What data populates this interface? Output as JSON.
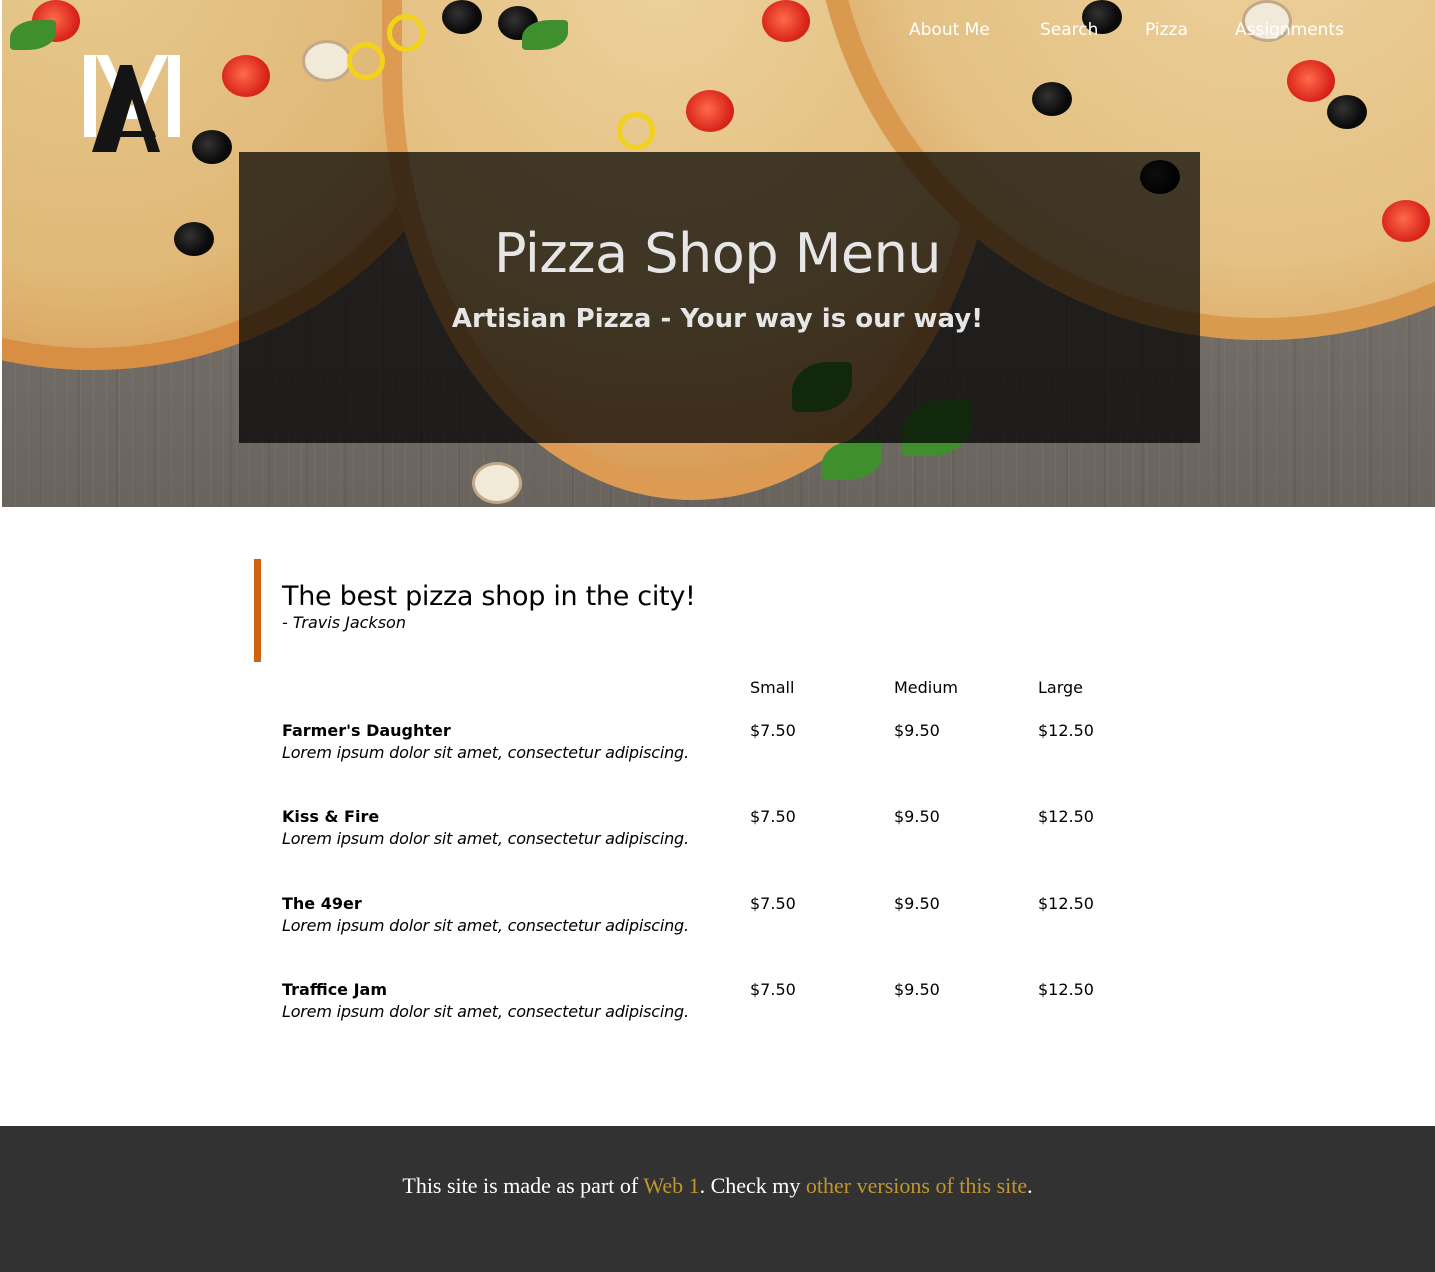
{
  "nav": {
    "items": [
      {
        "label": "About Me"
      },
      {
        "label": "Search"
      },
      {
        "label": "Pizza"
      },
      {
        "label": "Assignments"
      }
    ]
  },
  "logo": {
    "icon": "ma-monogram-logo-icon"
  },
  "hero": {
    "title": "Pizza Shop Menu",
    "subtitle": "Artisian Pizza - Your way is our way!"
  },
  "quote": {
    "text": "The best pizza shop in the city!",
    "author": "- Travis Jackson",
    "accent_color": "#d0630f"
  },
  "menu": {
    "columns": [
      "Small",
      "Medium",
      "Large"
    ],
    "items": [
      {
        "name": "Farmer's Daughter",
        "description": "Lorem ipsum dolor sit amet, consectetur adipiscing.",
        "prices": [
          "$7.50",
          "$9.50",
          "$12.50"
        ]
      },
      {
        "name": "Kiss & Fire",
        "description": "Lorem ipsum dolor sit amet, consectetur adipiscing.",
        "prices": [
          "$7.50",
          "$9.50",
          "$12.50"
        ]
      },
      {
        "name": "The 49er",
        "description": "Lorem ipsum dolor sit amet, consectetur adipiscing.",
        "prices": [
          "$7.50",
          "$9.50",
          "$12.50"
        ]
      },
      {
        "name": "Traffice Jam",
        "description": "Lorem ipsum dolor sit amet, consectetur adipiscing.",
        "prices": [
          "$7.50",
          "$9.50",
          "$12.50"
        ]
      }
    ]
  },
  "footer": {
    "prefix": "This site is made as part of ",
    "link1": "Web 1",
    "middle": ". Check my ",
    "link2": "other versions of this site",
    "suffix": ".",
    "background": "#323232",
    "link_color": "#c1962b"
  }
}
